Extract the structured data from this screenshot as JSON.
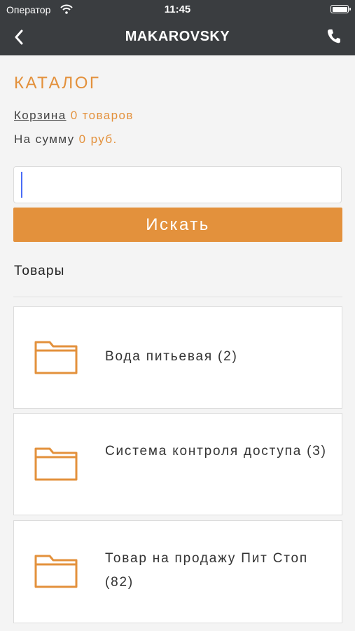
{
  "status_bar": {
    "carrier": "Оператор",
    "time": "11:45"
  },
  "nav": {
    "title": "MAKAROVSKY"
  },
  "catalog": {
    "heading": "КАТАЛОГ",
    "cart_link": "Корзина",
    "cart_count": "0 товаров",
    "sum_label": "На сумму",
    "sum_value": "0 руб."
  },
  "search": {
    "value": "",
    "placeholder": "",
    "button": "Искать"
  },
  "section": {
    "title": "Товары"
  },
  "categories": [
    {
      "label": "Вода питьевая (2)"
    },
    {
      "label": "Система контроля доступа (3)"
    },
    {
      "label": "Товар на продажу Пит Стоп (82)"
    }
  ],
  "colors": {
    "accent": "#e3913c",
    "bar": "#3a3d40"
  },
  "icons": {
    "back": "chevron-left-icon",
    "phone": "phone-icon",
    "folder": "folder-icon"
  }
}
